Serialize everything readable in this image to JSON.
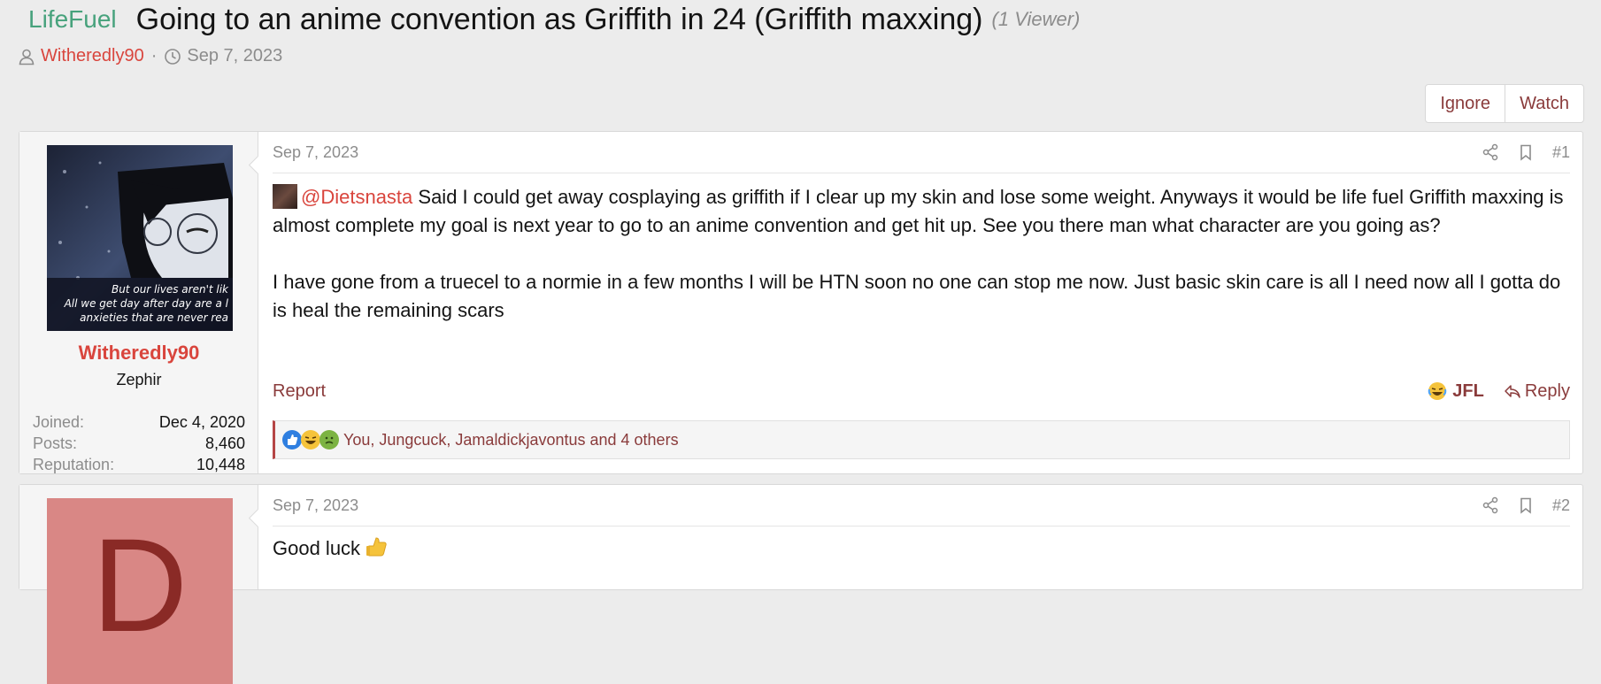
{
  "thread": {
    "prefix": "LifeFuel",
    "title": "Going to an anime convention as Griffith in 24 (Griffith maxxing)",
    "viewers": "(1 Viewer)",
    "author": "Witheredly90",
    "separator": "·",
    "date": "Sep 7, 2023"
  },
  "actions": {
    "ignore": "Ignore",
    "watch": "Watch"
  },
  "posts": [
    {
      "date": "Sep 7, 2023",
      "number": "#1",
      "user": {
        "name": "Witheredly90",
        "title": "Zephir",
        "avatar_caption_lines": [
          "But our lives aren't lik",
          "All we get day after day are a l",
          "anxieties that are never rea"
        ],
        "stats": [
          {
            "label": "Joined:",
            "value": "Dec 4, 2020"
          },
          {
            "label": "Posts:",
            "value": "8,460"
          },
          {
            "label": "Reputation:",
            "value": "10,448"
          }
        ]
      },
      "body": {
        "mention": "@Dietsnasta",
        "paragraph_1": " Said I could get away cosplaying as griffith if I clear up my skin and lose some weight. Anyways it would be life fuel Griffith maxxing is almost complete my goal is next year to go to an anime convention and get hit up. See you there man what character are you going as?",
        "paragraph_2": "I have gone from a truecel to a normie in a few months I will be HTN soon no one can stop me now. Just basic skin care is all I need now all I gotta do is heal the remaining scars"
      },
      "report_label": "Report",
      "reaction_label": "JFL",
      "reply_label": "Reply",
      "reactors": "You, Jungcuck, Jamaldickjavontus and 4 others"
    },
    {
      "date": "Sep 7, 2023",
      "number": "#2",
      "avatar_letter": "D",
      "body": "Good luck"
    }
  ],
  "colors": {
    "brand_link": "#8a3b3b",
    "username": "#d9453d",
    "prefix": "#47a27c",
    "muted": "#8c8c8c"
  }
}
